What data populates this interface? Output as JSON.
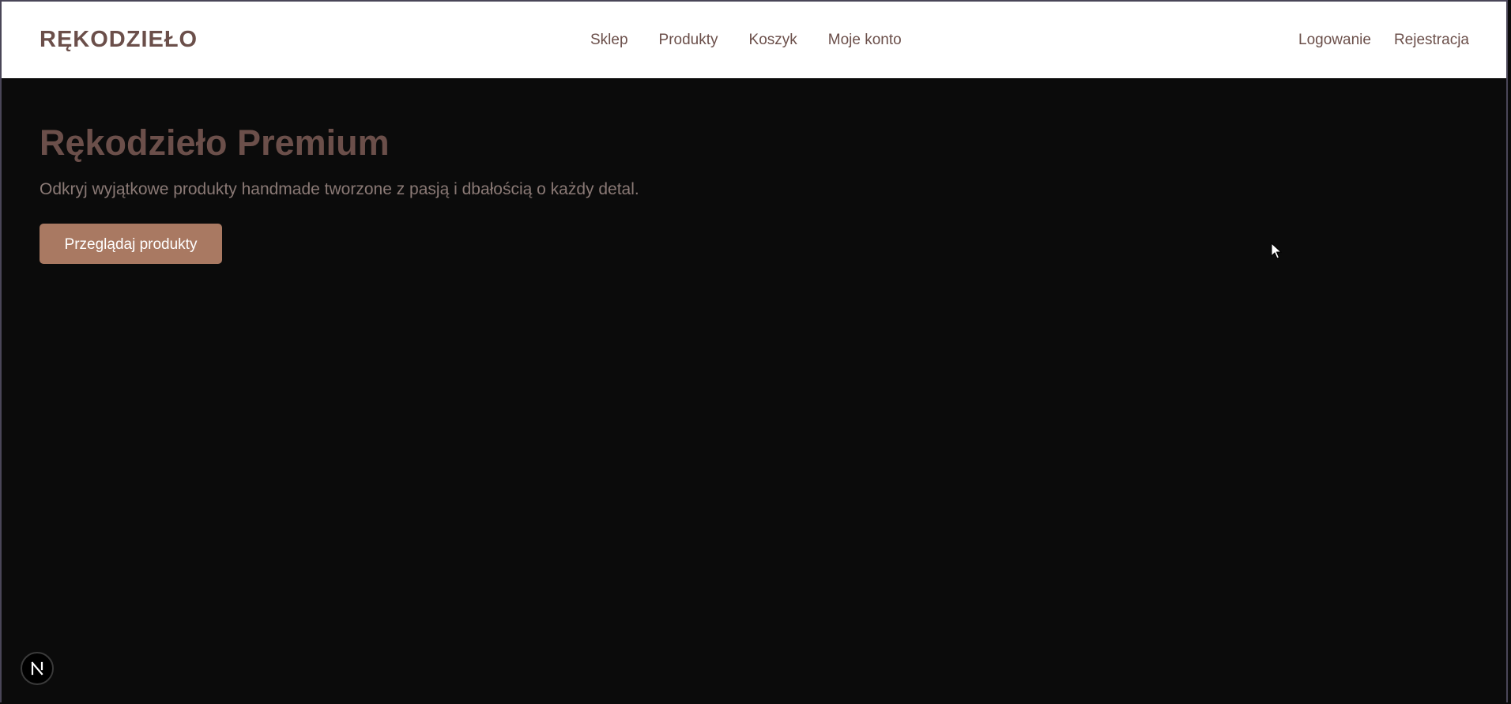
{
  "header": {
    "brand": "RĘKODZIEŁO",
    "nav": [
      "Sklep",
      "Produkty",
      "Koszyk",
      "Moje konto"
    ],
    "auth": [
      "Logowanie",
      "Rejestracja"
    ]
  },
  "hero": {
    "title": "Rękodzieło Premium",
    "subtitle": "Odkryj wyjątkowe produkty handmade tworzone z pasją i dbałością o każdy detal.",
    "cta_label": "Przeglądaj produkty"
  },
  "badge": {
    "icon": "next-logo-icon"
  },
  "colors": {
    "brand": "#6b4f4a",
    "accent": "#a97962",
    "background": "#0b0b0b",
    "header_bg": "#ffffff"
  }
}
